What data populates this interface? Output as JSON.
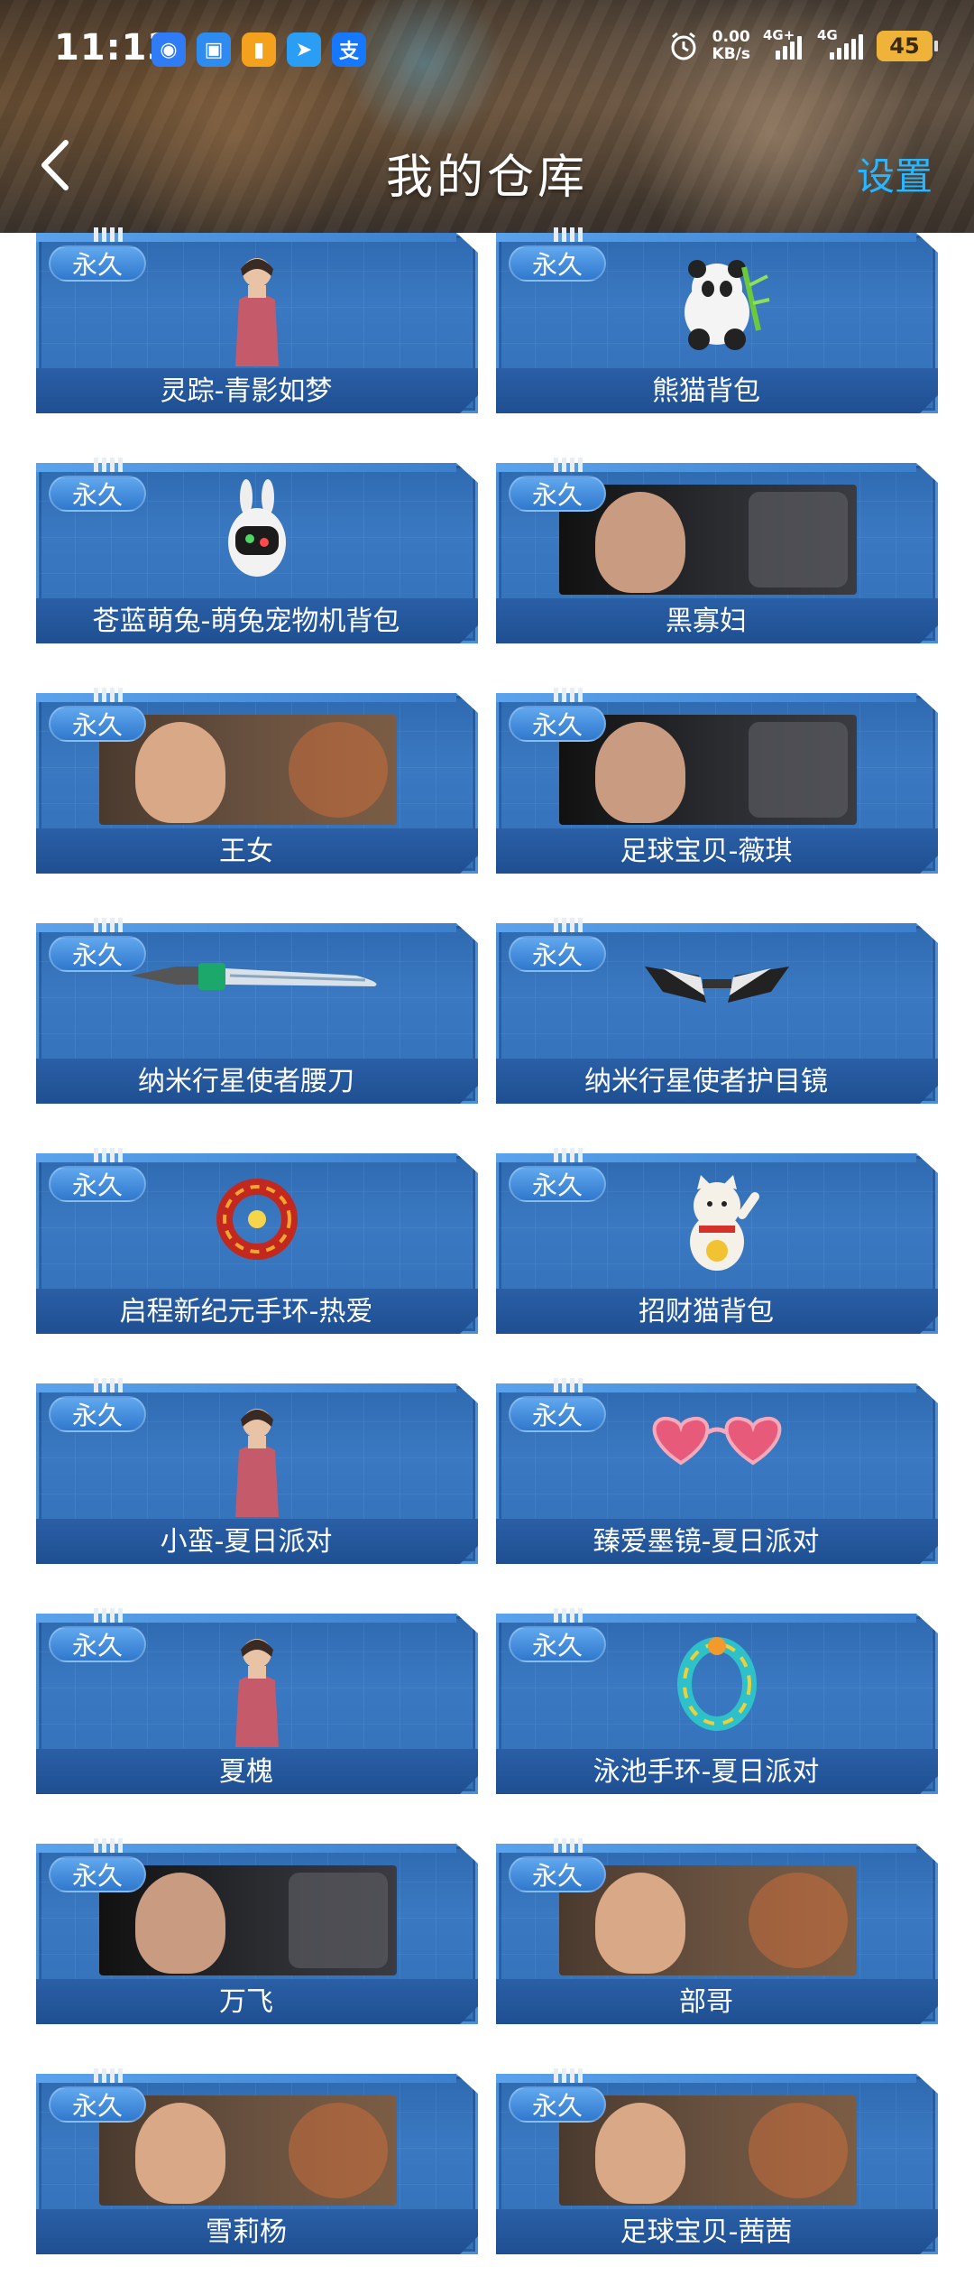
{
  "status_bar": {
    "time": "11:13",
    "net_speed_value": "0.00",
    "net_speed_unit": "KB/s",
    "signal1_label": "4G+",
    "signal2_label": "4G",
    "battery": "45",
    "app_icons": [
      {
        "name": "app-icon-1",
        "glyph": "◉",
        "color": "#2f7cf6"
      },
      {
        "name": "app-icon-2",
        "glyph": "▣",
        "color": "#2e8cf0"
      },
      {
        "name": "app-icon-3",
        "glyph": "▮",
        "color": "#f4a21e"
      },
      {
        "name": "telegram-icon",
        "glyph": "➤",
        "color": "#2a9df4"
      },
      {
        "name": "alipay-icon",
        "glyph": "支",
        "color": "#1677ff"
      }
    ]
  },
  "nav": {
    "title": "我的仓库",
    "settings": "设置"
  },
  "badge_text": "永久",
  "items": [
    {
      "label": "灵踪-青影如梦",
      "art": "character"
    },
    {
      "label": "熊猫背包",
      "art": "panda"
    },
    {
      "label": "苍蓝萌兔-萌兔宠物机背包",
      "art": "robot-bunny"
    },
    {
      "label": "黑寡妇",
      "art": "portrait-dark"
    },
    {
      "label": "王女",
      "art": "portrait-warm"
    },
    {
      "label": "足球宝贝-薇琪",
      "art": "portrait-dark"
    },
    {
      "label": "纳米行星使者腰刀",
      "art": "knife"
    },
    {
      "label": "纳米行星使者护目镜",
      "art": "goggles"
    },
    {
      "label": "启程新纪元手环-热爱",
      "art": "bracelet-red"
    },
    {
      "label": "招财猫背包",
      "art": "lucky-cat"
    },
    {
      "label": "小蛮-夏日派对",
      "art": "character"
    },
    {
      "label": "臻爱墨镜-夏日派对",
      "art": "heart-glasses"
    },
    {
      "label": "夏槐",
      "art": "character"
    },
    {
      "label": "泳池手环-夏日派对",
      "art": "bracelet-blue"
    },
    {
      "label": "万飞",
      "art": "portrait-dark"
    },
    {
      "label": "部哥",
      "art": "portrait-warm"
    },
    {
      "label": "雪莉杨",
      "art": "portrait-warm"
    },
    {
      "label": "足球宝贝-茜茜",
      "art": "portrait-warm"
    }
  ]
}
